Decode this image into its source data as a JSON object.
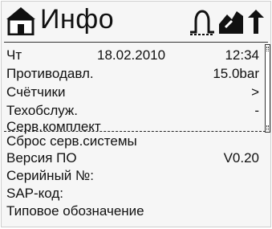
{
  "header": {
    "title": "Инфо",
    "icons": [
      "home-icon",
      "sensor-signal-icon",
      "feed-icon",
      "exit-up-icon"
    ]
  },
  "rows": [
    {
      "label": "Чт",
      "mid": "18.02.2010",
      "value": "12:34"
    },
    {
      "label": "Противодавл.",
      "value": "15.0bar"
    },
    {
      "label": "Счётчики",
      "value": ">"
    },
    {
      "label": "Техобслуж.",
      "value": "-"
    },
    {
      "label": "Серв.комплект",
      "value": ""
    },
    {
      "label": "Сброс серв.системы",
      "value": ""
    },
    {
      "label": "Версия ПО",
      "value": "V0.20"
    },
    {
      "label": "Серийный №:",
      "value": ""
    },
    {
      "label": "SAP-код:",
      "value": ""
    },
    {
      "label": "Типовое обозначение",
      "value": ""
    }
  ]
}
